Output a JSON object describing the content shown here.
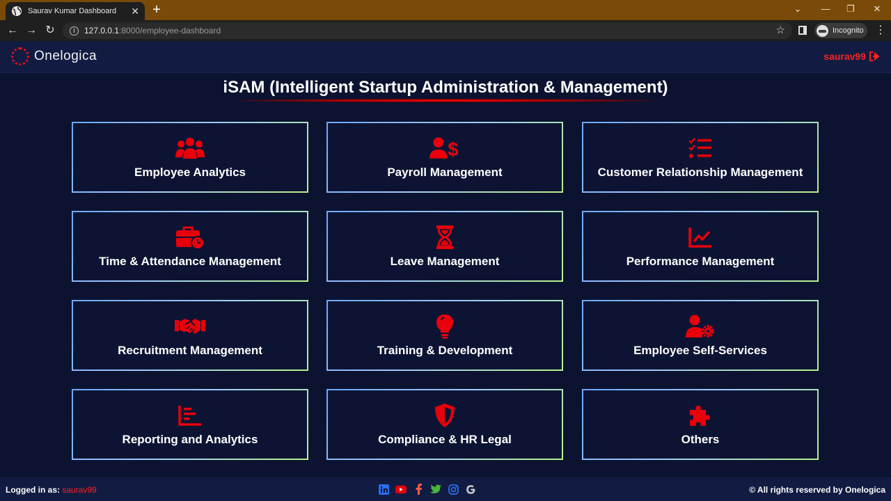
{
  "browser": {
    "tab_title": "Saurav Kumar Dashboard",
    "url_host": "127.0.0.1",
    "url_rest": ":8000/employee-dashboard",
    "incognito_label": "Incognito"
  },
  "header": {
    "logo_text": "Onelogica",
    "username": "saurav99"
  },
  "main": {
    "title": "iSAM (Intelligent Startup Administration & Management)",
    "accent_color": "#ff0000",
    "cards": [
      {
        "label": "Employee Analytics",
        "icon": "users-icon"
      },
      {
        "label": "Payroll Management",
        "icon": "user-dollar-icon"
      },
      {
        "label": "Customer Relationship Management",
        "icon": "checklist-icon"
      },
      {
        "label": "Time & Attendance Management",
        "icon": "briefcase-clock-icon"
      },
      {
        "label": "Leave Management",
        "icon": "hourglass-icon"
      },
      {
        "label": "Performance Management",
        "icon": "line-chart-icon"
      },
      {
        "label": "Recruitment Management",
        "icon": "handshake-icon"
      },
      {
        "label": "Training & Development",
        "icon": "lightbulb-icon"
      },
      {
        "label": "Employee Self-Services",
        "icon": "user-gear-icon"
      },
      {
        "label": "Reporting and Analytics",
        "icon": "bar-chart-icon"
      },
      {
        "label": "Compliance & HR Legal",
        "icon": "shield-icon"
      },
      {
        "label": "Others",
        "icon": "puzzle-icon"
      }
    ]
  },
  "footer": {
    "logged_in_label": "Logged in as:",
    "username": "saurav99",
    "rights": "© All rights reserved by Onelogica",
    "socials": [
      "linkedin-icon",
      "youtube-icon",
      "facebook-icon",
      "twitter-icon",
      "instagram-icon",
      "google-icon"
    ]
  }
}
